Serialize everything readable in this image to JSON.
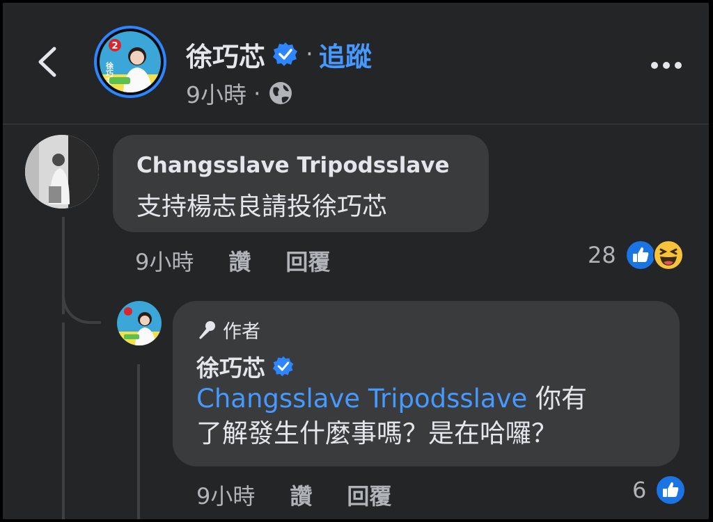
{
  "header": {
    "page_name": "徐巧芯",
    "follow_label": "追蹤",
    "separator": "·",
    "time": "9小時",
    "privacy_icon": "globe-icon"
  },
  "comment": {
    "author": "Changsslave Tripodsslave",
    "text": "支持楊志良請投徐巧芯",
    "time": "9小時",
    "like_label": "讚",
    "reply_label": "回覆",
    "reaction_count": "28",
    "reactions": [
      "like-reaction-icon",
      "haha-reaction-icon"
    ]
  },
  "reply": {
    "badge_label": "作者",
    "author": "徐巧芯",
    "mention": "Changsslave Tripodsslave",
    "text_line1_rest": " 你有",
    "text_line2": "了解發生什麼事嗎？是在哈囉？",
    "time": "9小時",
    "like_label": "讚",
    "reply_label": "回覆",
    "reaction_count": "6",
    "reactions": [
      "like-reaction-icon"
    ]
  },
  "avatar_text": {
    "number": "2",
    "name": "徐巧芯"
  },
  "colors": {
    "background": "#242526",
    "bubble": "#3a3b3c",
    "accent": "#4599ff",
    "verified": "#2d86ff"
  }
}
